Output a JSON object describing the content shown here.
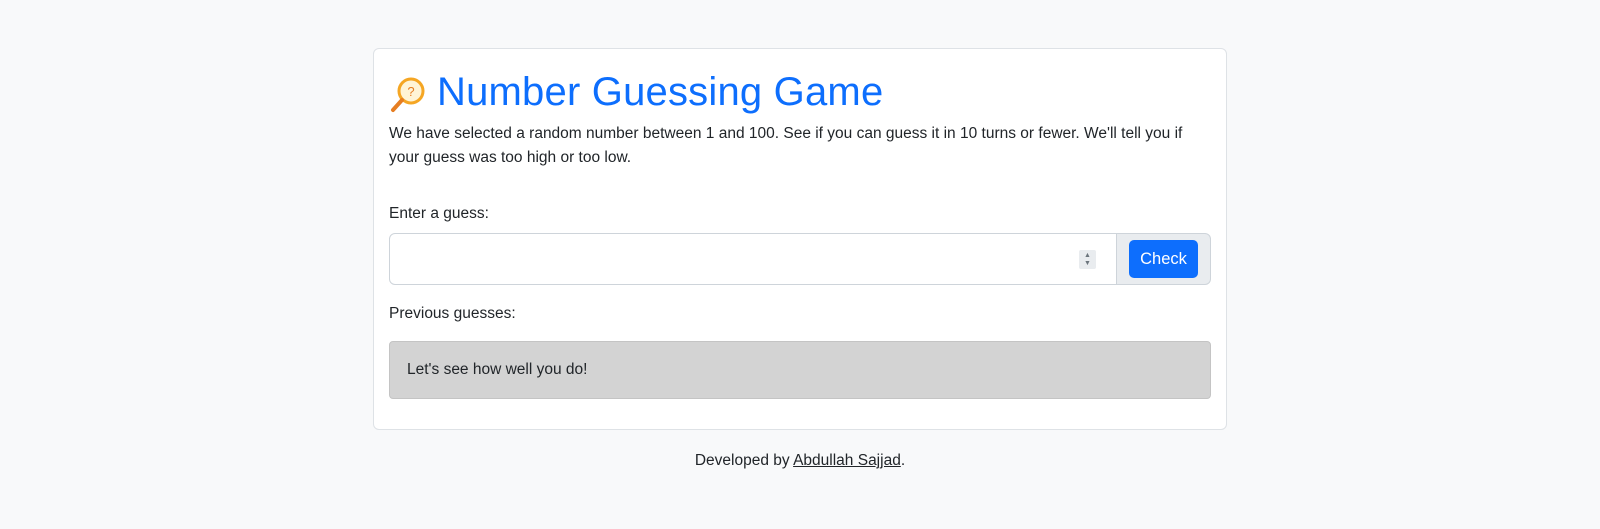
{
  "game": {
    "title": "Number Guessing Game",
    "icon": "magnifier-question-icon",
    "intro": "We have selected a random number between 1 and 100. See if you can guess it in 10 turns or fewer. We'll tell you if your guess was too high or too low.",
    "guess_label": "Enter a guess:",
    "guess_value": "",
    "check_label": "Check",
    "previous_label": "Previous guesses:",
    "result_message": "Let's see how well you do!"
  },
  "footer": {
    "prefix": "Developed by ",
    "author": "Abdullah Sajjad",
    "suffix": "."
  },
  "colors": {
    "accent": "#0d6efd",
    "background": "#f8f9fa",
    "result_bg": "#d3d3d3",
    "icon_orange": "#f39c12"
  }
}
